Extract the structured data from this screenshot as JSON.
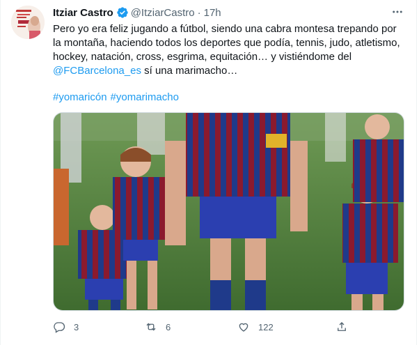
{
  "tweet": {
    "author_name": "Itziar Castro",
    "handle": "@ItziarCastro",
    "separator": "·",
    "time": "17h",
    "text_part1": "Pero yo era feliz jugando a fútbol, siendo una cabra montesa trepando por la montaña, haciendo todos los deportes que podía, tennis, judo, atletismo, hockey, natación, cross, esgrima, equitación… y vistiéndome del ",
    "mention": "@FCBarcelona_es",
    "text_part2": " sí una marimacho…",
    "hashtags": [
      "#yomaricón",
      "#yomarimacho"
    ],
    "replies": "3",
    "retweets": "6",
    "likes": "122"
  },
  "colors": {
    "accent": "#1d9bf0",
    "text": "#0f1419",
    "secondary": "#536471",
    "jersey_blue": "#1f3a8a",
    "jersey_red": "#8b1a2e",
    "grass": "#4f7d3a"
  },
  "icons": [
    "verified-badge-icon",
    "more-options-icon",
    "reply-icon",
    "retweet-icon",
    "like-icon",
    "share-icon"
  ]
}
